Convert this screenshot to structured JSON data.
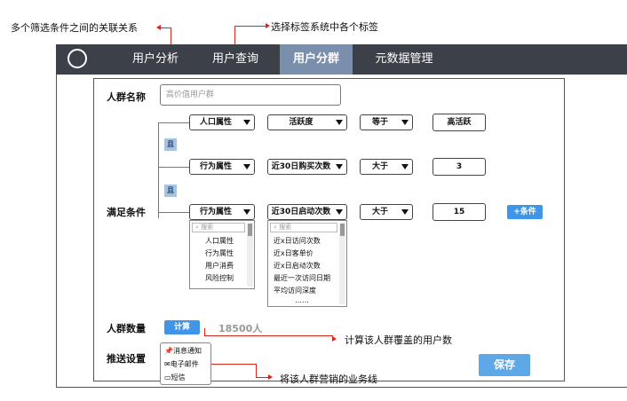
{
  "annotations": {
    "relation": "多个筛选条件之间的关联关系",
    "tag_select": "选择标签系统中各个标签",
    "count_note": "计算该人群覆盖的用户数",
    "channel_note": "将该人群营销的业务线"
  },
  "nav": {
    "items": [
      "用户分析",
      "用户查询",
      "用户分群",
      "元数据管理"
    ],
    "active": "用户分群"
  },
  "form": {
    "group_name_label": "人群名称",
    "group_name_placeholder": "高价值用户群",
    "conditions_label": "满足条件",
    "and_label": "且",
    "rows": [
      {
        "attr": "人口属性",
        "field": "活跃度",
        "op": "等于",
        "value": "高活跃"
      },
      {
        "attr": "行为属性",
        "field": "近30日购买次数",
        "op": "大于",
        "value": "3"
      },
      {
        "attr": "行为属性",
        "field": "近30日启动次数",
        "op": "大于",
        "value": "15"
      }
    ],
    "add_condition": "+条件",
    "dropdown1": {
      "search": "搜索",
      "items": [
        "人口属性",
        "行为属性",
        "用户消费",
        "风险控制"
      ]
    },
    "dropdown2": {
      "search": "搜索",
      "items": [
        "近x日访问次数",
        "近x日客单价",
        "近x日启动次数",
        "最近一次访问日期",
        "平均访问深度",
        "……"
      ]
    },
    "count_label": "人群数量",
    "calc_button": "计算",
    "count_value": "18500人",
    "push_label": "推送设置",
    "push_items": [
      "消息通知",
      "电子邮件",
      "短信"
    ],
    "save_button": "保存"
  },
  "colors": {
    "nav_bg": "#3b4049",
    "nav_active": "#7a8fab",
    "accent": "#3f96e8",
    "and_tag": "#a7c3e4",
    "annotation_line": "#d9261c"
  }
}
